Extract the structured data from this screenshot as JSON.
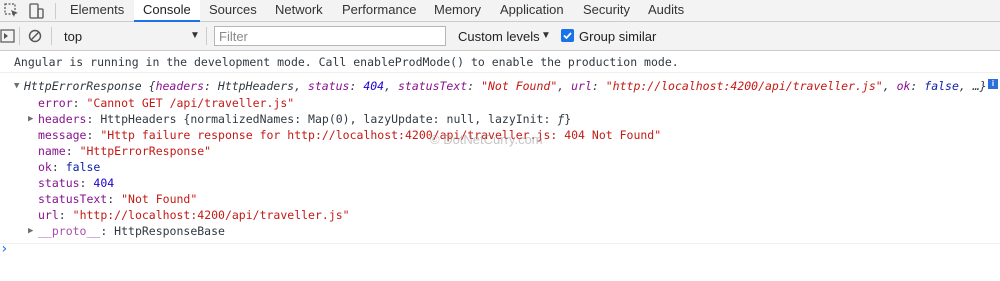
{
  "tabs": [
    "Elements",
    "Console",
    "Sources",
    "Network",
    "Performance",
    "Memory",
    "Application",
    "Security",
    "Audits"
  ],
  "toolbar": {
    "context": "top",
    "filter_placeholder": "Filter",
    "levels": "Custom levels",
    "group_similar": "Group similar"
  },
  "console": {
    "info_message": "Angular is running in the development mode. Call enableProdMode() to enable the production mode.",
    "summary": {
      "type": "HttpErrorResponse",
      "open": " {",
      "k1": "headers",
      "v1": "HttpHeaders",
      "k2": "status",
      "v2": "404",
      "k3": "statusText",
      "v3": "\"Not Found\"",
      "k4": "url",
      "v4": "\"http://localhost:4200/api/traveller.js\"",
      "k5": "ok",
      "v5": "false",
      "tail": ", …}"
    },
    "props": {
      "error_key": "error",
      "error_val": "\"Cannot GET /api/traveller.js\"",
      "headers_key": "headers",
      "headers_type": "HttpHeaders",
      "headers_detail": " {normalizedNames: Map(0), lazyUpdate: null, lazyInit: ",
      "headers_f": "ƒ",
      "headers_close": "}",
      "message_key": "message",
      "message_val": "\"Http failure response for http://localhost:4200/api/traveller.js: 404 Not Found\"",
      "name_key": "name",
      "name_val": "\"HttpErrorResponse\"",
      "ok_key": "ok",
      "ok_val": "false",
      "status_key": "status",
      "status_val": "404",
      "statusText_key": "statusText",
      "statusText_val": "\"Not Found\"",
      "url_key": "url",
      "url_val": "\"http://localhost:4200/api/traveller.js\"",
      "proto_key": "__proto__",
      "proto_val": "HttpResponseBase"
    },
    "watermark": "© DotNetCurry.com",
    "prompt": "›"
  }
}
